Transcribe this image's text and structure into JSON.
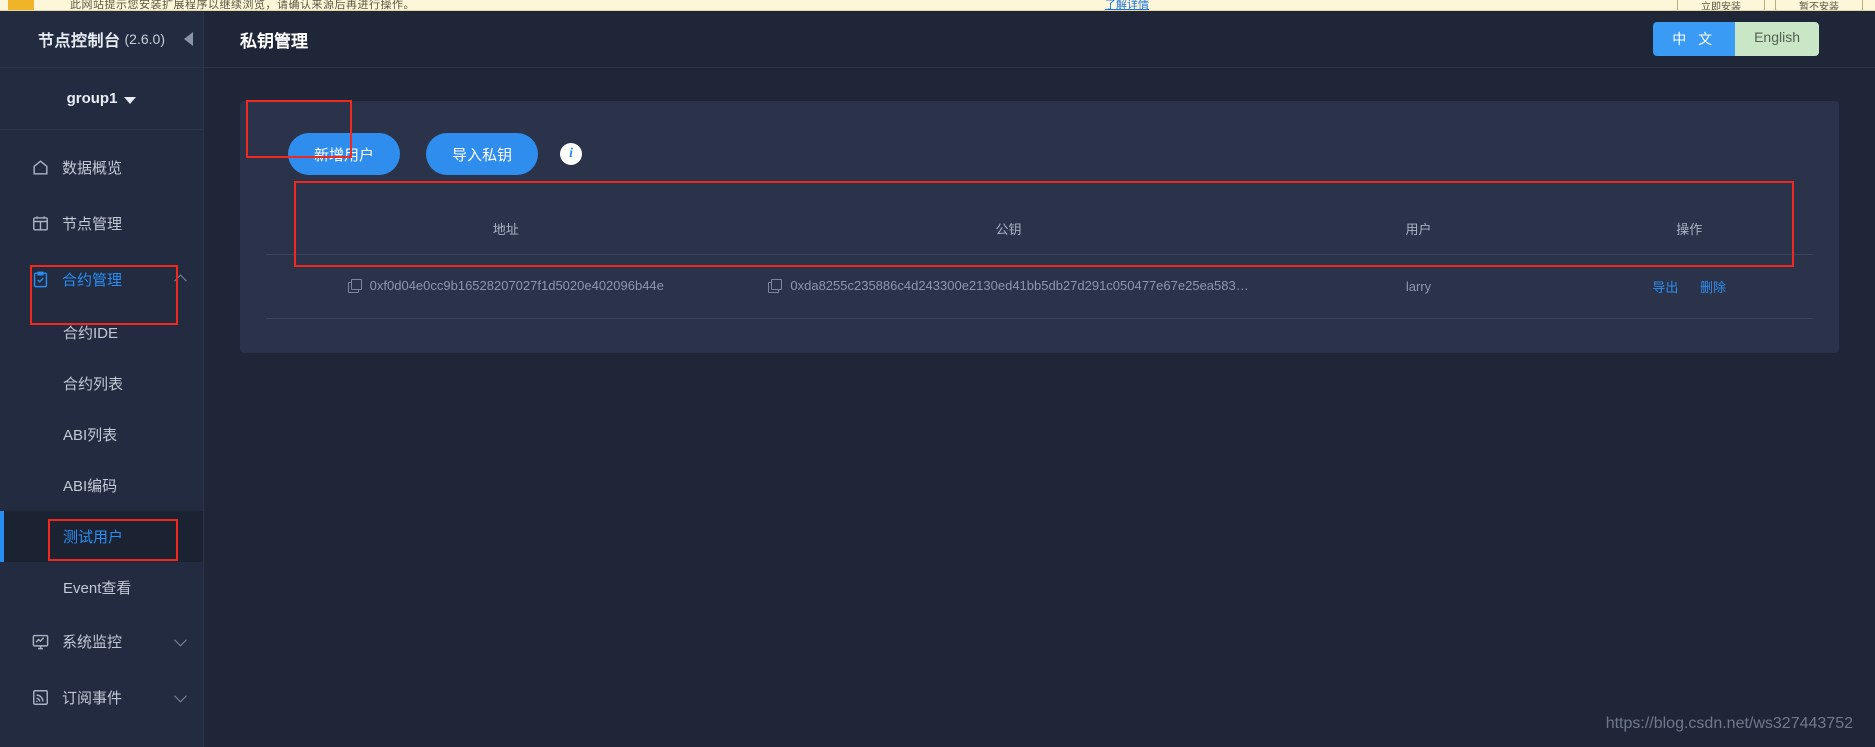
{
  "browser_bar": {
    "message": "此网站提示您安装扩展程序以继续浏览，请确认来源后再进行操作。",
    "link": "了解详情",
    "button_primary": "立即安装",
    "button_secondary": "暂不安装"
  },
  "sidebar": {
    "brand_title": "节点控制台",
    "brand_version": "(2.6.0)",
    "collapse_icon": "caret-left-icon",
    "group": {
      "name": "group1",
      "caret": "caret-down-icon"
    },
    "items": [
      {
        "label": "数据概览",
        "icon": "home-icon",
        "active": false,
        "expandable": false
      },
      {
        "label": "节点管理",
        "icon": "calendar-icon",
        "active": false,
        "expandable": false
      },
      {
        "label": "合约管理",
        "icon": "clipboard-check-icon",
        "active": true,
        "expandable": true,
        "expanded": true
      },
      {
        "label": "系统监控",
        "icon": "monitor-chart-icon",
        "active": false,
        "expandable": true,
        "expanded": false
      },
      {
        "label": "订阅事件",
        "icon": "rss-icon",
        "active": false,
        "expandable": true,
        "expanded": false
      }
    ],
    "submenu": [
      {
        "label": "合约IDE",
        "active": false
      },
      {
        "label": "合约列表",
        "active": false
      },
      {
        "label": "ABI列表",
        "active": false
      },
      {
        "label": "ABI编码",
        "active": false
      },
      {
        "label": "测试用户",
        "active": true
      },
      {
        "label": "Event查看",
        "active": false
      }
    ]
  },
  "header": {
    "page_title": "私钥管理",
    "language": {
      "zh_label": "中 文",
      "en_label": "English",
      "selected": "中 文"
    }
  },
  "toolbar": {
    "add_user_label": "新增用户",
    "import_key_label": "导入私钥",
    "info_icon": "info-icon"
  },
  "table": {
    "columns": [
      "地址",
      "公钥",
      "用户",
      "操作"
    ],
    "rows": [
      {
        "address": "0xf0d04e0cc9b16528207027f1d5020e402096b44e",
        "public_key": "0xda8255c235886c4d243300e2130ed41bb5db27d291c050477e67e25ea583…",
        "user": "larry",
        "actions": [
          "导出",
          "删除"
        ]
      }
    ]
  },
  "watermark": "https://blog.csdn.net/ws327443752",
  "colors": {
    "accent_blue": "#2f8ded",
    "annotation_red": "#f0281e",
    "sidebar_bg": "#222b40",
    "page_bg": "#1f2638",
    "card_bg": "#2a334a"
  }
}
